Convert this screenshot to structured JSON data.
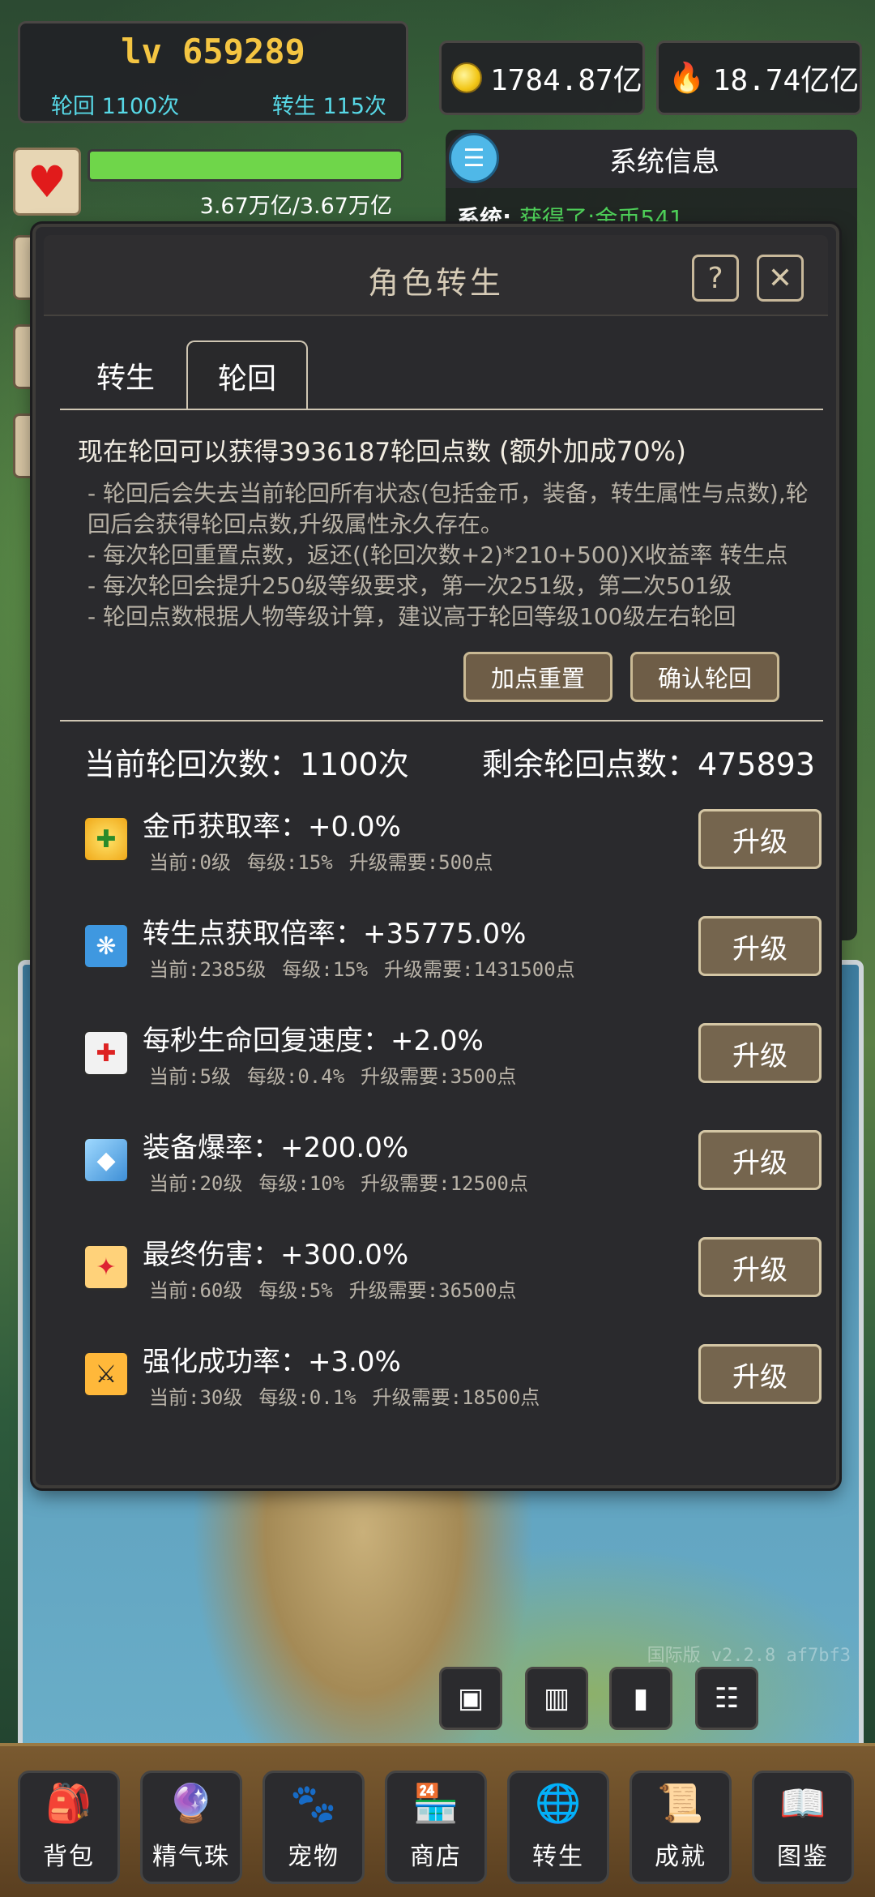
{
  "hud": {
    "level": "lv 659289",
    "lunhui_count": "轮回 1100次",
    "zhuansheng_count": "转生 115次",
    "gold": "1784.87亿",
    "fire": "18.74亿亿",
    "hp_text": "3.67万亿/3.67万亿",
    "hp_fraction": 1.0
  },
  "system": {
    "title": "系统信息",
    "line_prefix": "系统:",
    "line_text": "获得了:金币541"
  },
  "modal": {
    "title": "角色转生",
    "help": "?",
    "close": "✕",
    "tabs": [
      "转生",
      "轮回"
    ],
    "active_tab": "轮回",
    "desc_head": "现在轮回可以获得3936187轮回点数",
    "desc_bonus": "(额外加成70%)",
    "desc_items": [
      "- 轮回后会失去当前轮回所有状态(包括金币，装备，转生属性与点数),轮回后会获得轮回点数,升级属性永久存在。",
      "- 每次轮回重置点数，返还((轮回次数+2)*210+500)X收益率 转生点",
      "- 每次轮回会提升250级等级要求，第一次251级，第二次501级",
      "- 轮回点数根据人物等级计算，建议高于轮回等级100级左右轮回"
    ],
    "btn_reset": "加点重置",
    "btn_confirm": "确认轮回",
    "summary_left": "当前轮回次数：1100次",
    "summary_right": "剩余轮回点数：475893",
    "upgrade_label": "升级",
    "rows": [
      {
        "name": "金币获取率：+0.0%",
        "current": "当前:0级",
        "per": "每级:15%",
        "cost": "升级需要:500点",
        "icon": "✚"
      },
      {
        "name": "转生点获取倍率：+35775.0%",
        "current": "当前:2385级",
        "per": "每级:15%",
        "cost": "升级需要:1431500点",
        "icon": "❋"
      },
      {
        "name": "每秒生命回复速度：+2.0%",
        "current": "当前:5级",
        "per": "每级:0.4%",
        "cost": "升级需要:3500点",
        "icon": "✚"
      },
      {
        "name": "装备爆率：+200.0%",
        "current": "当前:20级",
        "per": "每级:10%",
        "cost": "升级需要:12500点",
        "icon": "◆"
      },
      {
        "name": "最终伤害：+300.0%",
        "current": "当前:60级",
        "per": "每级:5%",
        "cost": "升级需要:36500点",
        "icon": "✦"
      },
      {
        "name": "强化成功率：+3.0%",
        "current": "当前:30级",
        "per": "每级:0.1%",
        "cost": "升级需要:18500点",
        "icon": "⚔"
      }
    ]
  },
  "map": {
    "version": "国际版 v2.2.8  af7bf3",
    "buttons": [
      "▣",
      "▥",
      "▮",
      "☷"
    ]
  },
  "bottom_nav": [
    {
      "label": "背包",
      "icon": "🎒"
    },
    {
      "label": "精气珠",
      "icon": "🔮"
    },
    {
      "label": "宠物",
      "icon": "🐾"
    },
    {
      "label": "商店",
      "icon": "🏪"
    },
    {
      "label": "转生",
      "icon": "🌐"
    },
    {
      "label": "成就",
      "icon": "📜"
    },
    {
      "label": "图鉴",
      "icon": "📖"
    }
  ],
  "colors": {
    "level": "#f4c542",
    "cyan": "#57d8e6",
    "hp": "#6fd64a",
    "button": "#75654e"
  }
}
